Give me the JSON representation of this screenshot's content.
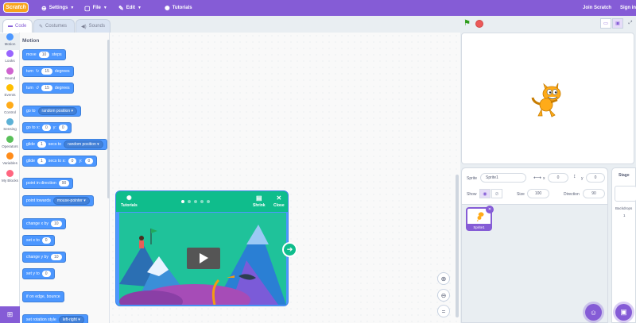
{
  "menubar": {
    "logo": "Scratch",
    "settings": "Settings",
    "file": "File",
    "edit": "Edit",
    "tutorials": "Tutorials",
    "join": "Join Scratch",
    "signin": "Sign in"
  },
  "tabs": {
    "code": "Code",
    "costumes": "Costumes",
    "sounds": "Sounds"
  },
  "categories": [
    {
      "label": "Motion",
      "color": "#4c97ff"
    },
    {
      "label": "Looks",
      "color": "#9966ff"
    },
    {
      "label": "Sound",
      "color": "#cf63cf"
    },
    {
      "label": "Events",
      "color": "#ffbf00"
    },
    {
      "label": "Control",
      "color": "#ffab19"
    },
    {
      "label": "Sensing",
      "color": "#5cb1d6"
    },
    {
      "label": "Operators",
      "color": "#59c059"
    },
    {
      "label": "Variables",
      "color": "#ff8c1a"
    },
    {
      "label": "My Blocks",
      "color": "#ff6680"
    }
  ],
  "palette": {
    "title": "Motion",
    "move": {
      "a": "move",
      "n": "10",
      "b": "steps"
    },
    "turn_right": {
      "a": "turn",
      "n": "15",
      "b": "degrees"
    },
    "turn_left": {
      "a": "turn",
      "n": "15",
      "b": "degrees"
    },
    "goto": {
      "a": "go to",
      "opt": "random position"
    },
    "gotoxy": {
      "a": "go to x:",
      "x": "0",
      "b": "y:",
      "y": "0"
    },
    "glide_to": {
      "a": "glide",
      "n": "1",
      "b": "secs to",
      "opt": "random position"
    },
    "glide_xy": {
      "a": "glide",
      "n": "1",
      "b": "secs to x:",
      "x": "0",
      "c": "y:",
      "y": "0"
    },
    "point_dir": {
      "a": "point in direction",
      "n": "90"
    },
    "point_towards": {
      "a": "point towards",
      "opt": "mouse-pointer"
    },
    "change_x": {
      "a": "change x by",
      "n": "10"
    },
    "set_x": {
      "a": "set x to",
      "n": "0"
    },
    "change_y": {
      "a": "change y by",
      "n": "10"
    },
    "set_y": {
      "a": "set y to",
      "n": "0"
    },
    "bounce": "if on edge, bounce",
    "rotation": {
      "a": "set rotation style",
      "opt": "left-right"
    }
  },
  "tutorial_card": {
    "tutorials": "Tutorials",
    "shrink": "Shrink",
    "close": "Close",
    "dots_total": 5,
    "dots_active": 1
  },
  "sprite_info": {
    "sprite_label": "Sprite",
    "sprite_name": "Sprite1",
    "x_label": "x",
    "x": "0",
    "y_label": "y",
    "y": "0",
    "show_label": "Show",
    "size_label": "Size",
    "size": "100",
    "direction_label": "Direction",
    "direction": "90"
  },
  "sprite_thumb": {
    "name": "Sprite1"
  },
  "stage_pane": {
    "title": "Stage",
    "backdrops_label": "Backdrops",
    "backdrops_count": "1"
  },
  "colors": {
    "accent": "#855cd6",
    "motion": "#4c97ff",
    "tutorial_green": "#0fbd8c"
  }
}
